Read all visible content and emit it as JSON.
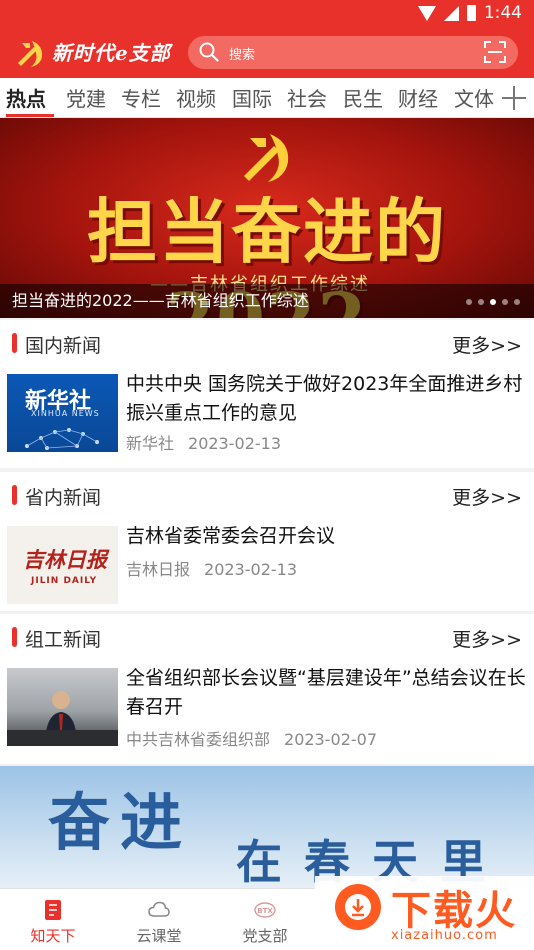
{
  "status_bar": {
    "time": "1:44"
  },
  "header": {
    "app_name": "新时代e支部",
    "search_placeholder": "搜索"
  },
  "tabs": [
    "热点",
    "党建",
    "专栏",
    "视频",
    "国际",
    "社会",
    "民生",
    "财经",
    "文体"
  ],
  "active_tab": "热点",
  "banner": {
    "title": "担当奋进的2022",
    "subtitle": "——吉林省组织工作综述",
    "caption": "担当奋进的2022——吉林省组织工作综述",
    "slide_count": 5,
    "active_slide": 3
  },
  "sections": [
    {
      "title": "国内新闻",
      "more": "更多>>",
      "item": {
        "title": "中共中央 国务院关于做好2023年全面推进乡村振兴重点工作的意见",
        "source": "新华社",
        "date": "2023-02-13",
        "thumb_text": "新华社",
        "thumb_sub": "XINHUA NEWS"
      }
    },
    {
      "title": "省内新闻",
      "more": "更多>>",
      "item": {
        "title": "吉林省委常委会召开会议",
        "source": "吉林日报",
        "date": "2023-02-13",
        "thumb_text": "吉林日报",
        "thumb_sub": "JILIN DAILY"
      }
    },
    {
      "title": "组工新闻",
      "more": "更多>>",
      "item": {
        "title": "全省组织部长会议暨“基层建设年”总结会议在长春召开",
        "source": "中共吉林省委组织部",
        "date": "2023-02-07"
      }
    }
  ],
  "banner2": {
    "line1": "奋进",
    "line2": "在春天里"
  },
  "bottom_nav": [
    {
      "label": "知天下",
      "icon": "news-icon",
      "active": true
    },
    {
      "label": "云课堂",
      "icon": "cloud-icon",
      "active": false
    },
    {
      "label": "党支部",
      "icon": "btx-icon",
      "active": false
    }
  ],
  "watermark": {
    "text": "下载火",
    "url": "xiazaihuo.com"
  },
  "colors": {
    "brand_red": "#e8312b",
    "meta_gray": "#888888"
  }
}
